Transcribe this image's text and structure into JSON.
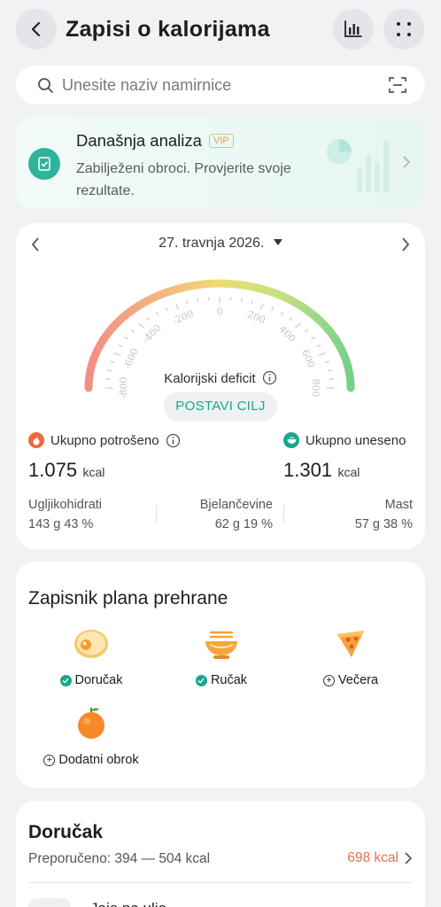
{
  "header": {
    "title": "Zapisi o kalorijama"
  },
  "search": {
    "placeholder": "Unesite naziv namirnice"
  },
  "analysis": {
    "title": "Današnja analiza",
    "badge": "VIP",
    "description_line1": "Zabilježeni obroci. Provjerite svoje",
    "description_line2": "rezultate."
  },
  "summary": {
    "date": "27. travnja 2026.",
    "gauge_ticks": [
      "-800",
      "-600",
      "-400",
      "-200",
      "0",
      "200",
      "400",
      "600",
      "800"
    ],
    "gauge_label": "Kalorijski deficit",
    "set_goal": "POSTAVI CILJ",
    "burned": {
      "label": "Ukupno potrošeno",
      "value": "1.075",
      "unit": "kcal"
    },
    "intake": {
      "label": "Ukupno uneseno",
      "value": "1.301",
      "unit": "kcal"
    },
    "macros": [
      {
        "name": "Ugljikohidrati",
        "value": "143 g  43 %"
      },
      {
        "name": "Bjelančevine",
        "value": "62 g  19 %"
      },
      {
        "name": "Mast",
        "value": "57 g  38 %"
      }
    ]
  },
  "plan": {
    "title": "Zapisnik plana prehrane",
    "meals": [
      {
        "label": "Doručak",
        "status": "logged",
        "icon": "egg-icon"
      },
      {
        "label": "Ručak",
        "status": "logged",
        "icon": "noodle-bowl-icon"
      },
      {
        "label": "Večera",
        "status": "empty",
        "icon": "pizza-slice-icon"
      },
      {
        "label": "Dodatni obrok",
        "status": "empty",
        "icon": "orange-icon"
      }
    ]
  },
  "breakfast": {
    "title": "Doručak",
    "recommended": "Preporučeno: 394 — 504 kcal",
    "total": "698 kcal",
    "first_item": "Jaje na ulje"
  },
  "colors": {
    "accent": "#1aa58e",
    "warning": "#e3734f",
    "vip": "#d9a54b"
  }
}
